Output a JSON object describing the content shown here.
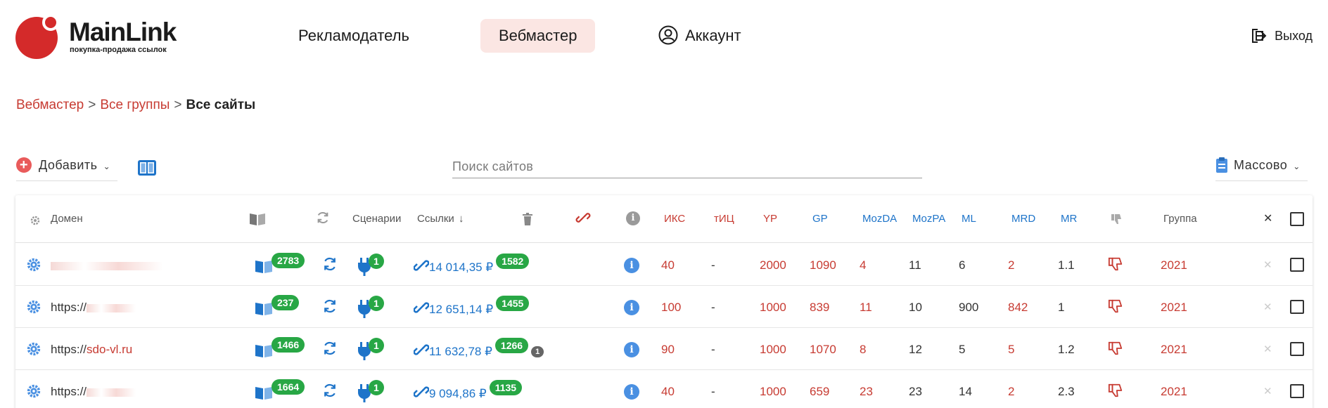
{
  "brand": {
    "name": "MainLink",
    "tagline": "покупка-продажа ссылок"
  },
  "nav": {
    "advertiser": "Рекламодатель",
    "webmaster": "Вебмастер",
    "account": "Аккаунт",
    "logout": "Выход"
  },
  "breadcrumb": {
    "item1": "Вебмастер",
    "item2": "Все группы",
    "current": "Все сайты",
    "separator": ">"
  },
  "toolbar": {
    "add_label": "Добавить",
    "search_placeholder": "Поиск сайтов",
    "mass_label": "Массово"
  },
  "table": {
    "headers": {
      "domain": "Домен",
      "scenarios": "Сценарии",
      "links": "Ссылки",
      "iks": "ИКС",
      "tic": "тИЦ",
      "yp": "YP",
      "gp": "GP",
      "mozda": "MozDA",
      "mozpa": "MozPA",
      "ml": "ML",
      "mrd": "MRD",
      "mr": "MR",
      "group": "Группа"
    },
    "rows": [
      {
        "domain_prefix": "",
        "domain_name": "",
        "pages": "2783",
        "scenarios": "1",
        "links_sum": "14 014,35 ₽",
        "links_count": "1582",
        "extra": "",
        "iks": "40",
        "tic": "-",
        "yp": "2000",
        "gp": "1090",
        "mozda": "4",
        "mozpa": "11",
        "ml": "6",
        "mrd": "2",
        "mr": "1.1",
        "group": "2021"
      },
      {
        "domain_prefix": "https://",
        "domain_name": "",
        "pages": "237",
        "scenarios": "1",
        "links_sum": "12 651,14 ₽",
        "links_count": "1455",
        "extra": "",
        "iks": "100",
        "tic": "-",
        "yp": "1000",
        "gp": "839",
        "mozda": "11",
        "mozpa": "10",
        "ml": "900",
        "mrd": "842",
        "mr": "1",
        "group": "2021"
      },
      {
        "domain_prefix": "https://",
        "domain_name": "sdo-vl.ru",
        "pages": "1466",
        "scenarios": "1",
        "links_sum": "11 632,78 ₽",
        "links_count": "1266",
        "extra": "1",
        "iks": "90",
        "tic": "-",
        "yp": "1000",
        "gp": "1070",
        "mozda": "8",
        "mozpa": "12",
        "ml": "5",
        "mrd": "5",
        "mr": "1.2",
        "group": "2021"
      },
      {
        "domain_prefix": "https://",
        "domain_name": "",
        "pages": "1664",
        "scenarios": "1",
        "links_sum": "9 094,86 ₽",
        "links_count": "1135",
        "extra": "",
        "iks": "40",
        "tic": "-",
        "yp": "1000",
        "gp": "659",
        "mozda": "23",
        "mozpa": "23",
        "ml": "14",
        "mrd": "2",
        "mr": "2.3",
        "group": "2021"
      }
    ]
  },
  "colors": {
    "brand_red": "#d42a2a",
    "link_red": "#c73b32",
    "accent_blue": "#1e74c9",
    "badge_green": "#28a745",
    "nav_active_bg": "#fbe6e3"
  }
}
